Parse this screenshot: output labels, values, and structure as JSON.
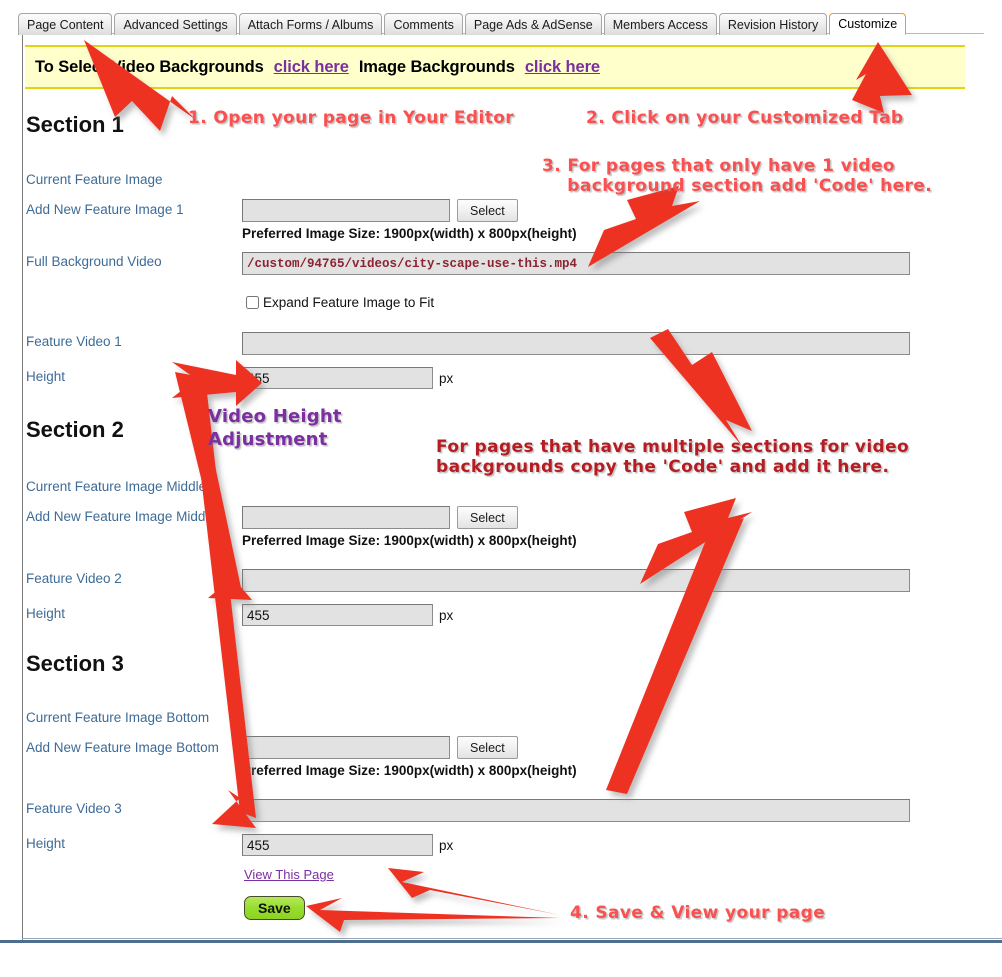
{
  "tabs": [
    {
      "label": "Page Content",
      "active": false
    },
    {
      "label": "Advanced Settings",
      "active": false
    },
    {
      "label": "Attach Forms / Albums",
      "active": false
    },
    {
      "label": "Comments",
      "active": false
    },
    {
      "label": "Page Ads & AdSense",
      "active": false
    },
    {
      "label": "Members Access",
      "active": false
    },
    {
      "label": "Revision History",
      "active": false
    },
    {
      "label": "Customize",
      "active": true
    }
  ],
  "notice": {
    "prefix": "To Select Video Backgrounds",
    "link1": "click here",
    "middle": "Image Backgrounds",
    "link2": "click here"
  },
  "sections": [
    {
      "title": "Section 1",
      "current_image_label": "Current Feature Image",
      "add_image_label": "Add New Feature Image 1",
      "add_image_value": "",
      "select_label": "Select",
      "preferred_size": "Preferred Image Size: 1900px(width) x 800px(height)",
      "full_bg_video_label": "Full Background Video",
      "full_bg_video_value": "/custom/94765/videos/city-scape-use-this.mp4",
      "expand_checkbox_label": "Expand Feature Image to Fit",
      "expand_checkbox_checked": false,
      "feature_video_label": "Feature Video 1",
      "feature_video_value": "",
      "height_label": "Height",
      "height_value": "455",
      "height_unit": "px"
    },
    {
      "title": "Section 2",
      "current_image_label": "Current Feature Image Middle",
      "add_image_label": "Add New Feature Image Middle",
      "add_image_value": "",
      "select_label": "Select",
      "preferred_size": "Preferred Image Size: 1900px(width) x 800px(height)",
      "feature_video_label": "Feature Video 2",
      "feature_video_value": "",
      "height_label": "Height",
      "height_value": "455",
      "height_unit": "px"
    },
    {
      "title": "Section 3",
      "current_image_label": "Current Feature Image Bottom",
      "add_image_label": "Add New Feature Image Bottom",
      "add_image_value": "",
      "select_label": "Select",
      "preferred_size": "Preferred Image Size: 1900px(width) x 800px(height)",
      "feature_video_label": "Feature Video 3",
      "feature_video_value": "",
      "height_label": "Height",
      "height_value": "455",
      "height_unit": "px"
    }
  ],
  "footer": {
    "view_link": "View This Page",
    "save_label": "Save"
  },
  "annotations": [
    {
      "id": "step1",
      "text": "1. Open your page in Your Editor",
      "style": "light"
    },
    {
      "id": "step2",
      "text": "2. Click on your Customized Tab",
      "style": "light"
    },
    {
      "id": "step3",
      "text": "3. For pages that only have 1 video\n    background section add 'Code' here.",
      "style": "light"
    },
    {
      "id": "video-height",
      "text": "Video Height\nAdjustment",
      "style": "purple"
    },
    {
      "id": "multi-section",
      "text": "For pages that have multiple sections for video\nbackgrounds copy the 'Code' and add it here.",
      "style": "dark"
    },
    {
      "id": "step4",
      "text": "4. Save & View your page",
      "style": "light"
    }
  ],
  "colors": {
    "arrow_red": "#ee3124",
    "annotation_light_red": "#fa5050",
    "annotation_dark_red": "#b51d22",
    "annotation_purple": "#7b2fa0",
    "notice_background": "#ffffcc",
    "notice_border": "#e3d316",
    "link_purple": "#7b2fa0",
    "label_blue": "#3d6b96",
    "video_path_text": "#8b2330",
    "save_green": "#95dd2e",
    "active_tab_border": "#e0a030"
  }
}
